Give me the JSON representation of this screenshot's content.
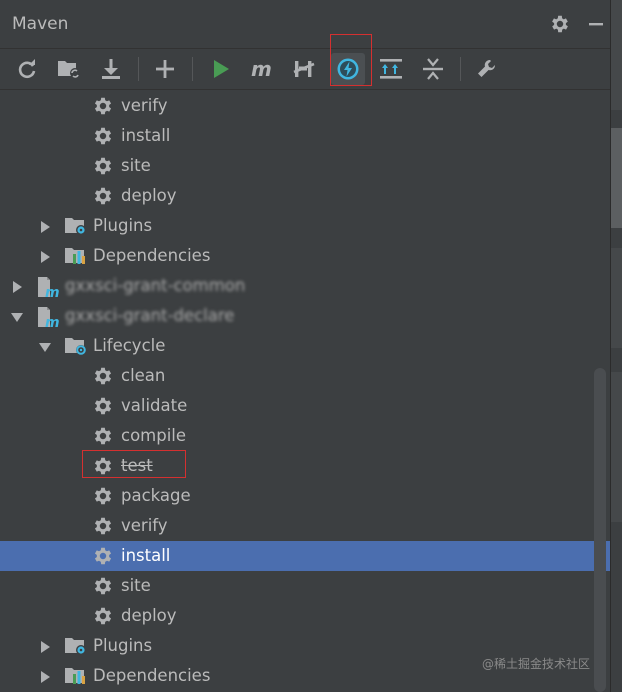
{
  "panel": {
    "title": "Maven"
  },
  "header_icons": [
    "gear-icon",
    "minimize-icon"
  ],
  "toolbar": {
    "buttons": [
      {
        "name": "reload-icon"
      },
      {
        "name": "generate-sources-icon"
      },
      {
        "name": "download-icon"
      },
      {
        "name": "add-icon"
      },
      {
        "name": "run-icon"
      },
      {
        "name": "execute-goal-icon"
      },
      {
        "name": "toggle-offline-icon"
      },
      {
        "name": "skip-tests-icon"
      },
      {
        "name": "show-dependencies-icon"
      },
      {
        "name": "collapse-all-icon"
      },
      {
        "name": "settings-icon"
      }
    ],
    "active": "skip-tests-icon"
  },
  "tree": [
    {
      "level": 3,
      "icon": "gear",
      "label": "verify"
    },
    {
      "level": 3,
      "icon": "gear",
      "label": "install"
    },
    {
      "level": 3,
      "icon": "gear",
      "label": "site"
    },
    {
      "level": 3,
      "icon": "gear",
      "label": "deploy"
    },
    {
      "level": 2,
      "icon": "plugins",
      "label": "Plugins",
      "arrow": "right"
    },
    {
      "level": 2,
      "icon": "deps",
      "label": "Dependencies",
      "arrow": "right"
    },
    {
      "level": 1,
      "icon": "maven",
      "label": "gxxsci-grant-common",
      "arrow": "right",
      "blurred": true
    },
    {
      "level": 1,
      "icon": "maven",
      "label": "gxxsci-grant-declare",
      "arrow": "down",
      "blurred": true
    },
    {
      "level": 2,
      "icon": "lifecycle",
      "label": "Lifecycle",
      "arrow": "down"
    },
    {
      "level": 3,
      "icon": "gear",
      "label": "clean"
    },
    {
      "level": 3,
      "icon": "gear",
      "label": "validate"
    },
    {
      "level": 3,
      "icon": "gear",
      "label": "compile"
    },
    {
      "level": 3,
      "icon": "gear",
      "label": "test",
      "strike": true
    },
    {
      "level": 3,
      "icon": "gear",
      "label": "package"
    },
    {
      "level": 3,
      "icon": "gear",
      "label": "verify"
    },
    {
      "level": 3,
      "icon": "gear",
      "label": "install",
      "selected": true
    },
    {
      "level": 3,
      "icon": "gear",
      "label": "site"
    },
    {
      "level": 3,
      "icon": "gear",
      "label": "deploy"
    },
    {
      "level": 2,
      "icon": "plugins",
      "label": "Plugins",
      "arrow": "right"
    },
    {
      "level": 2,
      "icon": "deps",
      "label": "Dependencies",
      "arrow": "right"
    }
  ],
  "watermark": "@稀土掘金技术社区",
  "colors": {
    "background": "#3c3f41",
    "selection": "#4b6eaf",
    "text": "#bbbbbb",
    "highlight": "#d43030",
    "run_green": "#499c54",
    "skip_blue": "#40b6e0"
  }
}
